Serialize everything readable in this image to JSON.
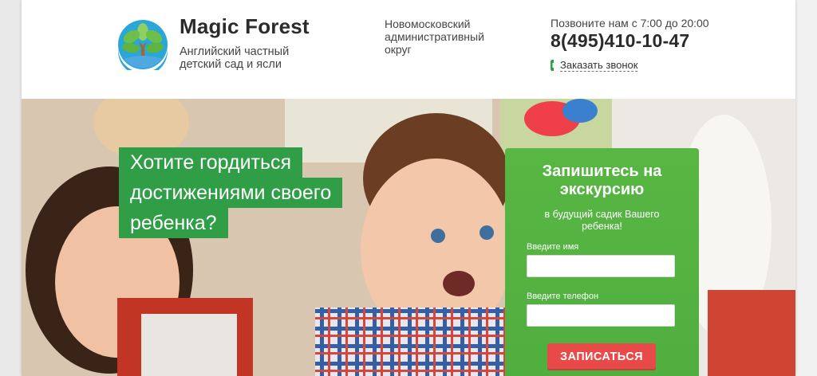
{
  "header": {
    "brand_name": "Magic Forest",
    "brand_tagline": "Английский частный детский сад и ясли",
    "district": "Новомосковский административный округ",
    "call_hours": "Позвоните нам с 7:00 до 20:00",
    "phone": "8(495)410-10-47",
    "callback_label": "Заказать звонок"
  },
  "hero": {
    "headline_lines": [
      "Хотите гордиться",
      "достижениями своего",
      "ребенка?"
    ]
  },
  "form": {
    "title": "Запишитесь на экскурсию",
    "subtitle": "в будущий садик Вашего ребенка!",
    "name_label": "Введите имя",
    "name_value": "",
    "phone_label": "Введите телефон",
    "phone_value": "",
    "submit_label": "ЗАПИСАТЬСЯ"
  },
  "icons": {
    "logo": "tree-logo-icon",
    "callback": "phone-handset-icon"
  },
  "colors": {
    "brand_green": "#2f9e46",
    "form_green": "#58b743",
    "submit_red": "#e84a4a",
    "logo_blue": "#2aa6d8",
    "logo_green": "#6cc04a",
    "logo_brown": "#9a6a3c"
  }
}
